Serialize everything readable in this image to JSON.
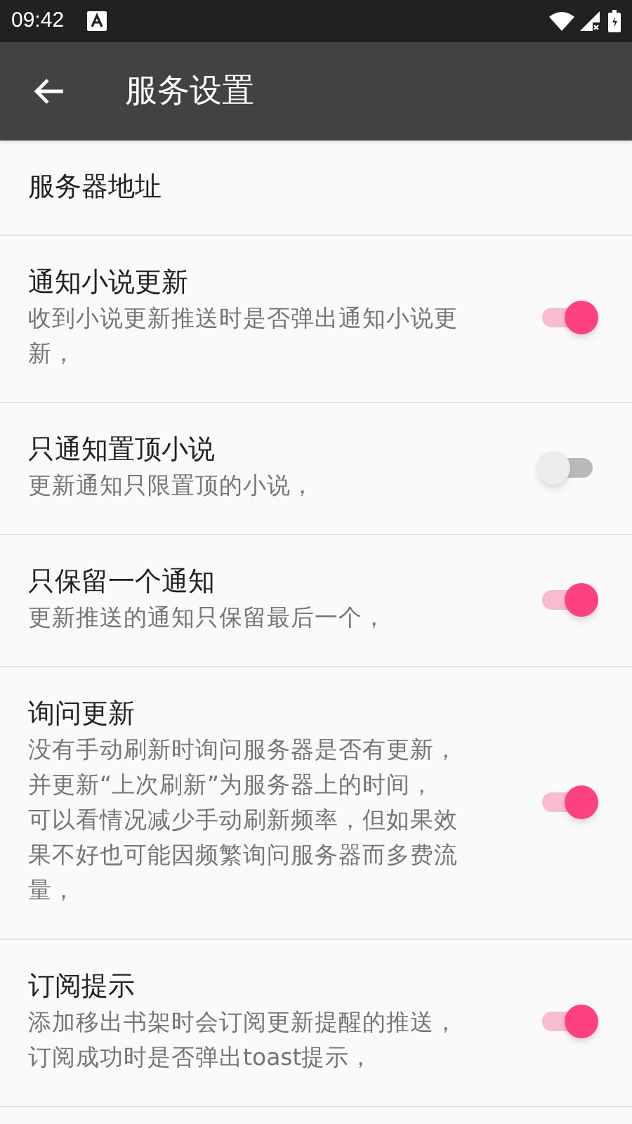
{
  "status_bar": {
    "time": "09:42"
  },
  "app_bar": {
    "title": "服务设置"
  },
  "settings": [
    {
      "kind": "plain",
      "title": "服务器地址"
    },
    {
      "kind": "switch",
      "title": "通知小说更新",
      "summary": [
        "收到小说更新推送时是否弹出通知小说更新，"
      ],
      "on": true
    },
    {
      "kind": "switch",
      "title": "只通知置顶小说",
      "summary": [
        "更新通知只限置顶的小说，"
      ],
      "on": false
    },
    {
      "kind": "switch",
      "title": "只保留一个通知",
      "summary": [
        "更新推送的通知只保留最后一个，"
      ],
      "on": true
    },
    {
      "kind": "switch",
      "title": "询问更新",
      "summary": [
        "没有手动刷新时询问服务器是否有更新，",
        "并更新“上次刷新”为服务器上的时间，",
        "可以看情况减少手动刷新频率，但如果效果不好也可能因频繁询问服务器而多费流量，"
      ],
      "on": true
    },
    {
      "kind": "switch",
      "title": "订阅提示",
      "summary": [
        "添加移出书架时会订阅更新提醒的推送，",
        "订阅成功时是否弹出toast提示，"
      ],
      "on": true
    }
  ]
}
